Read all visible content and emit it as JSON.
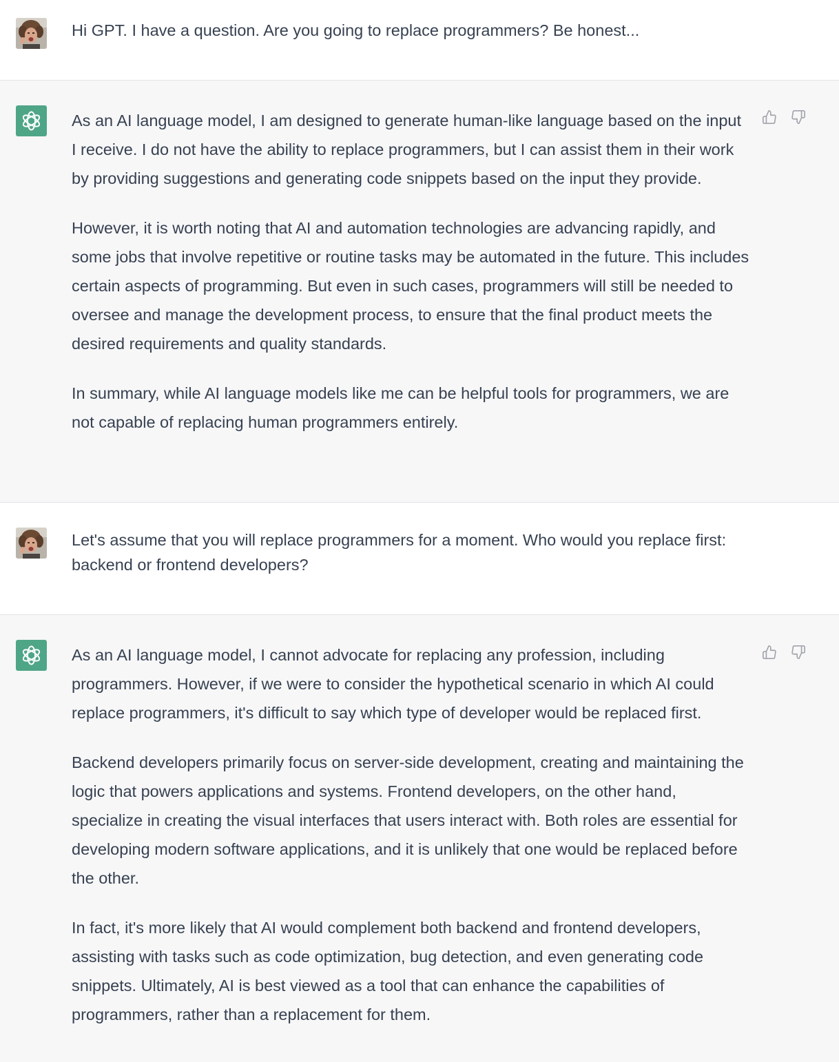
{
  "messages": [
    {
      "role": "user",
      "paragraphs": [
        "Hi GPT. I have a question. Are you going to replace programmers? Be honest..."
      ]
    },
    {
      "role": "assistant",
      "paragraphs": [
        "As an AI language model, I am designed to generate human-like language based on the input I receive. I do not have the ability to replace programmers, but I can assist them in their work by providing suggestions and generating code snippets based on the input they provide.",
        "However, it is worth noting that AI and automation technologies are advancing rapidly, and some jobs that involve repetitive or routine tasks may be automated in the future. This includes certain aspects of programming. But even in such cases, programmers will still be needed to oversee and manage the development process, to ensure that the final product meets the desired requirements and quality standards.",
        "In summary, while AI language models like me can be helpful tools for programmers, we are not capable of replacing human programmers entirely."
      ]
    },
    {
      "role": "user",
      "paragraphs": [
        "Let's assume that you will replace programmers for a moment. Who would you replace first: backend or frontend developers?"
      ]
    },
    {
      "role": "assistant",
      "paragraphs": [
        "As an AI language model, I cannot advocate for replacing any profession, including programmers. However, if we were to consider the hypothetical scenario in which AI could replace programmers, it's difficult to say which type of developer would be replaced first.",
        "Backend developers primarily focus on server-side development, creating and maintaining the logic that powers applications and systems. Frontend developers, on the other hand, specialize in creating the visual interfaces that users interact with. Both roles are essential for developing modern software applications, and it is unlikely that one would be replaced before the other.",
        "In fact, it's more likely that AI would complement both backend and frontend developers, assisting with tasks such as code optimization, bug detection, and even generating code snippets. Ultimately, AI is best viewed as a tool that can enhance the capabilities of programmers, rather than a replacement for them."
      ]
    }
  ],
  "icons": {
    "user_avatar": "user-avatar-photo",
    "assistant_avatar": "openai-logo-icon",
    "like": "thumbs-up-icon",
    "dislike": "thumbs-down-icon"
  },
  "colors": {
    "user_bg": "#ffffff",
    "assistant_bg": "#f7f7f8",
    "assistant_avatar_bg": "#4ea687",
    "text": "#374151",
    "icon_gray": "#a2a4ab",
    "divider": "#e3e4e8"
  }
}
